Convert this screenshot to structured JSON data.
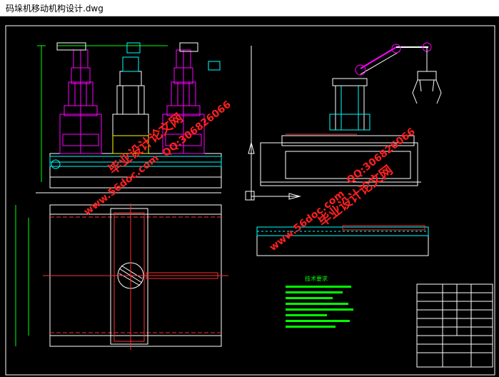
{
  "window": {
    "title": "码垛机移动机构设计.dwg"
  },
  "watermarks": [
    {
      "text": "毕业设计论文网",
      "color": "#ff2020"
    },
    {
      "text": "QQ:306826066",
      "color": "#ff2020"
    },
    {
      "text": "www.56doc.com",
      "color": "#ff2020"
    }
  ],
  "notes": {
    "heading": "技术要求"
  },
  "colors": {
    "background": "#000000",
    "frame": "#ffffff",
    "magenta": "#ff00ff",
    "cyan": "#00ffff",
    "green": "#00ff00",
    "red": "#ff3030",
    "yellow": "#ffff00"
  }
}
